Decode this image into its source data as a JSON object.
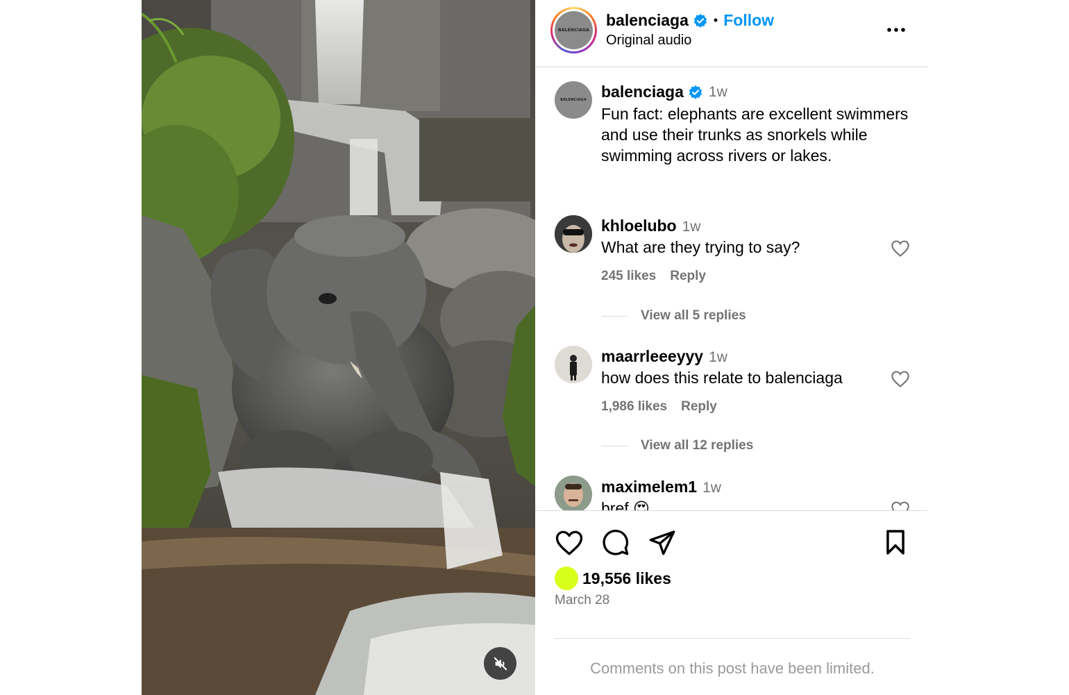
{
  "post": {
    "username": "balenciaga",
    "follow_label": "Follow",
    "separator": "•",
    "audio": "Original audio",
    "avatar_text": "BALENCIAGA"
  },
  "caption": {
    "username": "balenciaga",
    "time": "1w",
    "text": "Fun fact: elephants are excellent swimmers and use their trunks as snorkels while swimming across rivers or lakes."
  },
  "comments": [
    {
      "username": "khloelubo",
      "time": "1w",
      "text": "What are they trying to say?",
      "likes": "245 likes",
      "reply": "Reply",
      "view_replies": "View all 5 replies"
    },
    {
      "username": "maarrleeeyyy",
      "time": "1w",
      "text": "how does this relate to balenciaga",
      "likes": "1,986 likes",
      "reply": "Reply",
      "view_replies": "View all 12 replies"
    },
    {
      "username": "maximelem1",
      "time": "1w",
      "text": "bref 😍"
    }
  ],
  "stats": {
    "likes": "19,556 likes",
    "date": "March 28",
    "like_dot_color": "#d7ff1a"
  },
  "footer": {
    "limited": "Comments on this post have been limited."
  },
  "colors": {
    "accent": "#0095f6",
    "verified": "#0095f6",
    "muted_text": "#737373"
  },
  "icons": {
    "more": "more-options-icon",
    "like": "heart-icon",
    "comment": "comment-icon",
    "share": "share-icon",
    "save": "bookmark-icon",
    "mute": "speaker-muted-icon"
  }
}
